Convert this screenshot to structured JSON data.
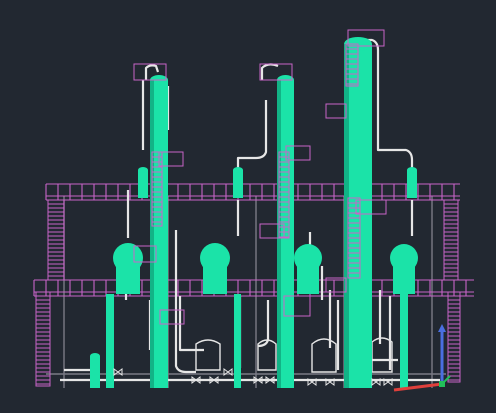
{
  "viewport": {
    "background": "#222831"
  },
  "colors": {
    "vessel": "#1BE3A8",
    "vessel_shade": "#12B386",
    "pipe": "#E6E6E6",
    "structure": "#C864C8",
    "structure_dim": "#A04CA0",
    "frame": "#7A7A85",
    "ucs_x": "#E0403C",
    "ucs_y": "#4A6FE0",
    "ucs_origin": "#22C05A"
  },
  "icons": {
    "ucs": "ucs-axis-icon"
  }
}
